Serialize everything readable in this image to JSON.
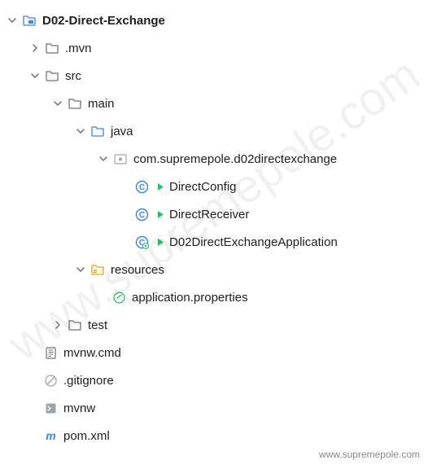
{
  "watermark_diag": "www.supremepole.com",
  "watermark_bottom": "www.supremepole.com",
  "tree": {
    "root": {
      "label": "D02-Direct-Exchange",
      "children": {
        "mvn": {
          "label": ".mvn"
        },
        "src": {
          "label": "src",
          "main": {
            "label": "main",
            "java": {
              "label": "java",
              "pkg": {
                "label": "com.supremepole.d02directexchange",
                "class1": "DirectConfig",
                "class2": "DirectReceiver",
                "class3": "D02DirectExchangeApplication"
              }
            },
            "resources": {
              "label": "resources",
              "props": "application.properties"
            }
          },
          "test": {
            "label": "test"
          }
        },
        "mvnwcmd": "mvnw.cmd",
        "gitignore": ".gitignore",
        "mvnw": "mvnw",
        "pom": "pom.xml"
      }
    }
  }
}
